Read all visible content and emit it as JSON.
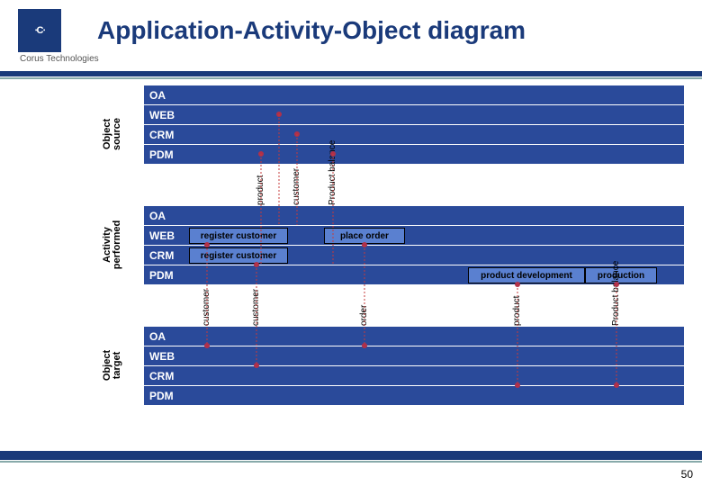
{
  "header": {
    "title": "Application-Activity-Object diagram",
    "company": "Corus Technologies"
  },
  "sections": {
    "source": {
      "label": "Object\nsource",
      "rows": [
        "OA",
        "WEB",
        "CRM",
        "PDM"
      ]
    },
    "activity": {
      "label": "Activity\nperformed",
      "rows": [
        "OA",
        "WEB",
        "CRM",
        "PDM"
      ]
    },
    "target": {
      "label": "Object\ntarget",
      "rows": [
        "OA",
        "WEB",
        "CRM",
        "PDM"
      ]
    }
  },
  "vlabels_top": [
    "product",
    "customer",
    "Product balance"
  ],
  "vlabels_mid": [
    "customer",
    "customer",
    "order",
    "product",
    "Product balance"
  ],
  "activities": {
    "web_cells": [
      "register customer",
      "place order"
    ],
    "crm_cells": [
      "register customer"
    ],
    "pdm_cells": [
      "product development",
      "production"
    ]
  },
  "page_number": "50"
}
